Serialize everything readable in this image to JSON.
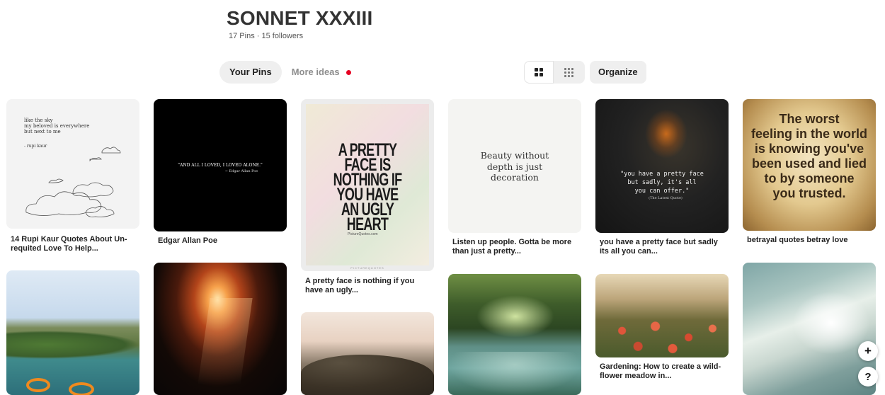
{
  "board": {
    "title": "SONNET XXXIII",
    "meta": "17 Pins · 15 followers"
  },
  "tabs": [
    {
      "label": "Your Pins"
    },
    {
      "label": "More ideas"
    }
  ],
  "toolbar": {
    "organize_label": "Organize"
  },
  "pins": [
    {
      "caption": "14 Rupi Kaur Quotes About Un-requited Love To Help...",
      "quote_lines": [
        "like the sky",
        "my beloved is everywhere",
        "but next to me"
      ],
      "quote_author": "- rupi kaur"
    },
    {
      "caption": "Edgar Allan Poe",
      "quote": "\"AND ALL I LOVED, I LOVED ALONE.\"",
      "quote_author": "~ Edgar Allan Poe"
    },
    {
      "caption": "A pretty face is nothing if you have an ugly...",
      "quote_lines": [
        "A PRETTY",
        "FACE IS",
        "NOTHING IF",
        "YOU HAVE",
        "AN UGLY",
        "HEART"
      ],
      "watermark": "PictureQuotes.com",
      "footer": "PICTUREQUOTES"
    },
    {
      "caption": "Listen up people. Gotta be more than just a pretty...",
      "quote_lines": [
        "Beauty without",
        "depth is just",
        "decoration"
      ]
    },
    {
      "caption": "you have a pretty face but sadly its all you can...",
      "quote_lines": [
        "\"you have a pretty face",
        "but sadly, it's all",
        "you can offer.\""
      ],
      "quote_author": "(The Latest Quote)"
    },
    {
      "caption": "betrayal quotes betray love",
      "quote_lines": [
        "The worst",
        "feeling in the world",
        "is knowing you've",
        "been used and lied",
        "to by someone",
        "you trusted."
      ]
    },
    {
      "caption": "Gardening: How to create a wild-flower meadow in..."
    }
  ],
  "fab": {
    "add_label": "+",
    "help_label": "?"
  }
}
